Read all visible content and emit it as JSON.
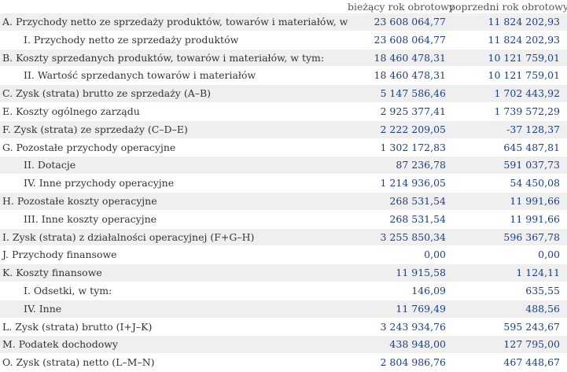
{
  "header": {
    "col_current": "bieżący rok obrotowy",
    "col_previous": "poprzedni rok obrotowy"
  },
  "rows": [
    {
      "label": "A. Przychody netto ze sprzedaży produktów, towarów i materiałów, w tym:",
      "current": "23 608 064,77",
      "previous": "11 824 202,93"
    },
    {
      "label": "I. Przychody netto ze sprzedaży produktów",
      "current": "23 608 064,77",
      "previous": "11 824 202,93"
    },
    {
      "label": "B. Koszty sprzedanych produktów, towarów i materiałów, w tym:",
      "current": "18 460 478,31",
      "previous": "10 121 759,01"
    },
    {
      "label": "II. Wartość sprzedanych towarów i materiałów",
      "current": "18 460 478,31",
      "previous": "10 121 759,01"
    },
    {
      "label": "C. Zysk (strata) brutto ze sprzedaży (A–B)",
      "current": "5 147 586,46",
      "previous": "1 702 443,92"
    },
    {
      "label": "E. Koszty ogólnego zarządu",
      "current": "2 925 377,41",
      "previous": "1 739 572,29"
    },
    {
      "label": "F. Zysk (strata) ze sprzedaży (C–D–E)",
      "current": "2 222 209,05",
      "previous": "-37 128,37"
    },
    {
      "label": "G. Pozostałe przychody operacyjne",
      "current": "1 302 172,83",
      "previous": "645 487,81"
    },
    {
      "label": "II. Dotacje",
      "current": "87 236,78",
      "previous": "591 037,73"
    },
    {
      "label": "IV. Inne przychody operacyjne",
      "current": "1 214 936,05",
      "previous": "54 450,08"
    },
    {
      "label": "H. Pozostałe koszty operacyjne",
      "current": "268 531,54",
      "previous": "11 991,66"
    },
    {
      "label": "III. Inne koszty operacyjne",
      "current": "268 531,54",
      "previous": "11 991,66"
    },
    {
      "label": "I. Zysk (strata) z działalności operacyjnej (F+G–H)",
      "current": "3 255 850,34",
      "previous": "596 367,78"
    },
    {
      "label": "J. Przychody finansowe",
      "current": "0,00",
      "previous": "0,00"
    },
    {
      "label": "K. Koszty finansowe",
      "current": "11 915,58",
      "previous": "1 124,11"
    },
    {
      "label": "I. Odsetki, w tym:",
      "current": "146,09",
      "previous": "635,55"
    },
    {
      "label": "IV. Inne",
      "current": "11 769,49",
      "previous": "488,56"
    },
    {
      "label": "L. Zysk (strata) brutto (I+J–K)",
      "current": "3 243 934,76",
      "previous": "595 243,67"
    },
    {
      "label": "M. Podatek dochodowy",
      "current": "438 948,00",
      "previous": "127 795,00"
    },
    {
      "label": "O. Zysk (strata) netto (L–M–N)",
      "current": "2 804 986,76",
      "previous": "467 448,67"
    }
  ]
}
